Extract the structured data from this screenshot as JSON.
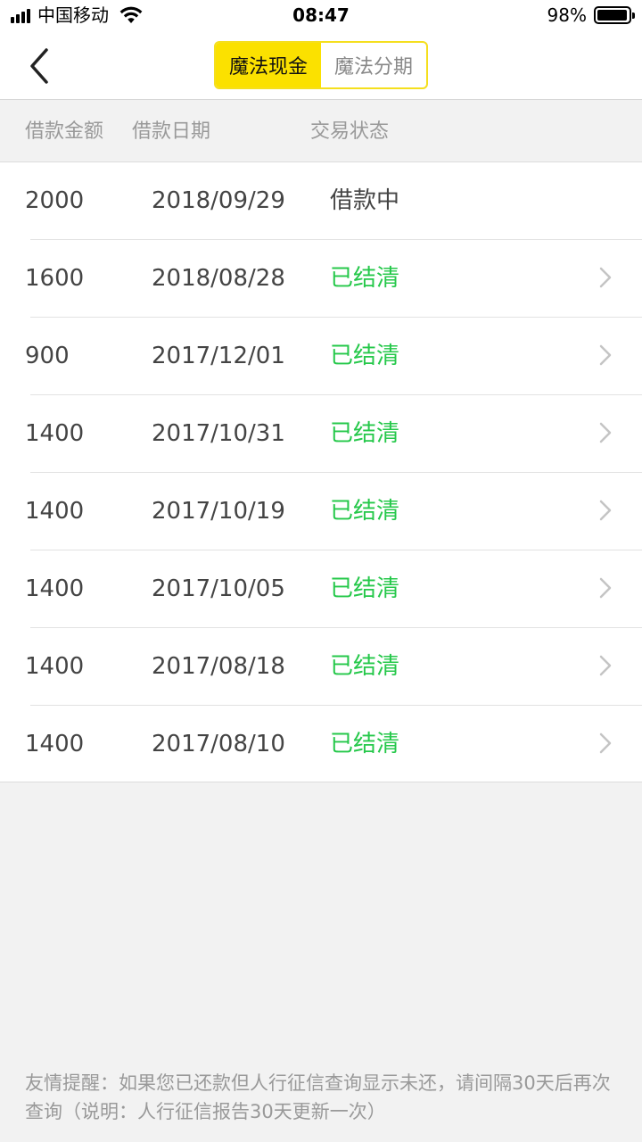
{
  "status_bar": {
    "carrier": "中国移动",
    "time": "08:47",
    "battery_percent": "98%",
    "battery_level": 0.98,
    "icons": [
      "signal-icon",
      "wifi-icon",
      "battery-icon"
    ]
  },
  "nav": {
    "back_icon": "chevron-left-icon",
    "tabs": [
      {
        "label": "魔法现金",
        "active": true
      },
      {
        "label": "魔法分期",
        "active": false
      }
    ]
  },
  "table": {
    "headers": [
      "借款金额",
      "借款日期",
      "交易状态"
    ],
    "rows": [
      {
        "amount": "2000",
        "date": "2018/09/29",
        "status": "借款中",
        "settled": false,
        "chevron": false
      },
      {
        "amount": "1600",
        "date": "2018/08/28",
        "status": "已结清",
        "settled": true,
        "chevron": true
      },
      {
        "amount": "900",
        "date": "2017/12/01",
        "status": "已结清",
        "settled": true,
        "chevron": true
      },
      {
        "amount": "1400",
        "date": "2017/10/31",
        "status": "已结清",
        "settled": true,
        "chevron": true
      },
      {
        "amount": "1400",
        "date": "2017/10/19",
        "status": "已结清",
        "settled": true,
        "chevron": true
      },
      {
        "amount": "1400",
        "date": "2017/10/05",
        "status": "已结清",
        "settled": true,
        "chevron": true
      },
      {
        "amount": "1400",
        "date": "2017/08/18",
        "status": "已结清",
        "settled": true,
        "chevron": true
      },
      {
        "amount": "1400",
        "date": "2017/08/10",
        "status": "已结清",
        "settled": true,
        "chevron": true
      }
    ]
  },
  "footer": {
    "tip": "友情提醒：如果您已还款但人行征信查询显示未还，请间隔30天后再次查询（说明：人行征信报告30天更新一次）"
  },
  "colors": {
    "accent_yellow": "#fbe100",
    "settled_green": "#25c84a",
    "text_gray": "#999999"
  }
}
